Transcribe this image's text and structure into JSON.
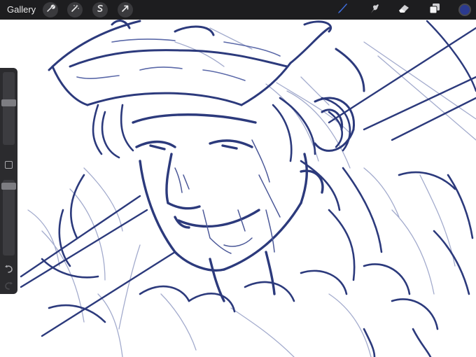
{
  "app": {
    "gallery_label": "Gallery"
  },
  "colors": {
    "ink": "#2c3a7c",
    "ink_light": "#9aa3c8",
    "toolbar_bg": "#1d1d1f",
    "sidebar_bg": "#2b2b2e",
    "brush_active": "#3f6fe0",
    "current_color": "#2b3a8f"
  },
  "toolbar": {
    "left_tools": [
      {
        "name": "actions",
        "icon": "wrench-icon"
      },
      {
        "name": "adjustments",
        "icon": "magic-wand-icon"
      },
      {
        "name": "selection",
        "icon": "selection-s-icon"
      },
      {
        "name": "transform",
        "icon": "arrow-cursor-icon"
      }
    ],
    "right_tools": [
      {
        "name": "brush",
        "icon": "brush-icon",
        "active": true
      },
      {
        "name": "smudge",
        "icon": "smudge-finger-icon",
        "active": false
      },
      {
        "name": "eraser",
        "icon": "eraser-icon",
        "active": false
      },
      {
        "name": "layers",
        "icon": "layers-icon",
        "active": false
      }
    ]
  },
  "sidebar": {
    "brush_size_level": 0.58,
    "opacity_level": 0.96,
    "undo_icon": "undo-arrow-icon",
    "redo_icon": "redo-arrow-icon"
  }
}
